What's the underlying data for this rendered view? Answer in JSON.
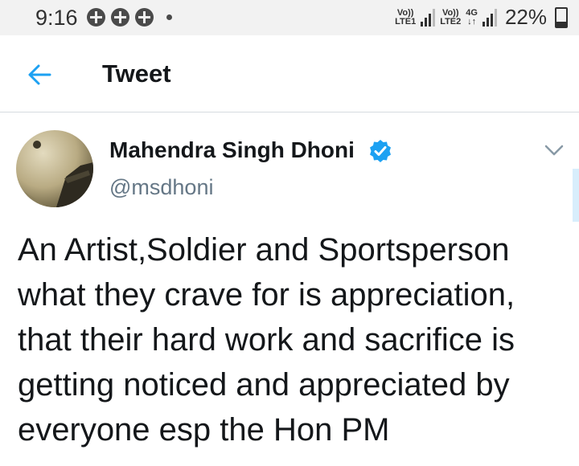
{
  "status_bar": {
    "time": "9:16",
    "sim1": {
      "top": "Vo))",
      "bottom": "LTE1"
    },
    "sim2": {
      "top": "Vo))",
      "bottom": "LTE2"
    },
    "network": "4G",
    "battery": "22%"
  },
  "header": {
    "back_icon": "back-arrow-icon",
    "title": "Tweet"
  },
  "tweet": {
    "author_name": "Mahendra Singh Dhoni",
    "handle": "@msdhoni",
    "verified": true,
    "text": "An Artist,Soldier and Sportsperson what they crave for is appreciation, that their hard work and sacrifice is getting noticed and appreciated by everyone esp the Hon PM"
  },
  "colors": {
    "accent": "#1da1f2",
    "text": "#14171a",
    "secondary_text": "#657786",
    "divider": "#d6dbdf",
    "status_bar_bg": "#f2f2f2"
  }
}
